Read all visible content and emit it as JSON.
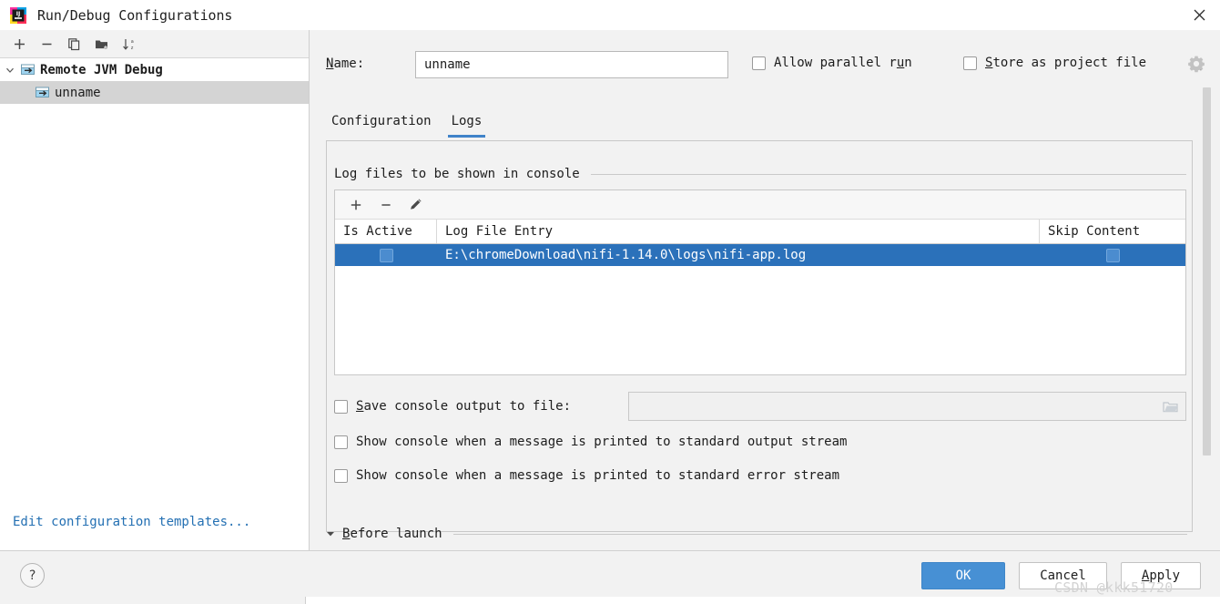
{
  "window": {
    "title": "Run/Debug Configurations",
    "logo_icon": "intellij-idea-logo",
    "close_icon": "close-icon"
  },
  "sidebar": {
    "toolbar": [
      {
        "icon": "plus-icon",
        "label": "+"
      },
      {
        "icon": "minus-icon",
        "label": "−"
      },
      {
        "icon": "copy-icon",
        "label": ""
      },
      {
        "icon": "folder-add-icon",
        "label": ""
      },
      {
        "icon": "sort-alphabetically-icon",
        "label": ""
      }
    ],
    "tree": [
      {
        "label": "Remote JVM Debug",
        "icon": "remote-jvm-debug-icon",
        "expanded": true,
        "selected": false
      },
      {
        "label": "unname",
        "icon": "run-config-icon",
        "expanded": false,
        "selected": true
      }
    ],
    "edit_templates_link": "Edit configuration templates..."
  },
  "main": {
    "name_label": "Name:",
    "name_label_mnemonic": "N",
    "name_value": "unname",
    "allow_parallel_run": {
      "label": "Allow parallel run",
      "mnemonic": "u",
      "checked": false
    },
    "store_as_project_file": {
      "label": "Store as project file",
      "mnemonic": "S",
      "checked": false
    },
    "gear_icon": "gear-dropdown-icon",
    "tabs": [
      {
        "label": "Configuration",
        "active": false
      },
      {
        "label": "Logs",
        "active": true
      }
    ]
  },
  "logs": {
    "section_title": "Log files to be shown in console",
    "table_toolbar": [
      {
        "icon": "plus-icon",
        "label": "+"
      },
      {
        "icon": "minus-icon",
        "label": "−"
      },
      {
        "icon": "edit-pencil-icon",
        "label": ""
      }
    ],
    "columns": [
      "Is Active",
      "Log File Entry",
      "Skip Content"
    ],
    "rows": [
      {
        "is_active": true,
        "log_file_entry": "E:\\chromeDownload\\nifi-1.14.0\\logs\\nifi-app.log",
        "skip_content": true,
        "selected": true
      }
    ],
    "save_console_output": {
      "label": "Save console output to file:",
      "mnemonic": "S",
      "checked": false,
      "value": "",
      "placeholder": "",
      "browse_icon": "folder-browse-icon"
    },
    "show_console_stdout": {
      "label": "Show console when a message is printed to standard output stream",
      "checked": false
    },
    "show_console_stderr": {
      "label": "Show console when a message is printed to standard error stream",
      "checked": false
    }
  },
  "before_launch": {
    "label": "Before launch",
    "mnemonic": "B",
    "expanded": true,
    "twisty_icon": "chevron-down-icon"
  },
  "footer": {
    "help_label": "?",
    "help_icon": "help-icon",
    "ok_label": "OK",
    "cancel_label": "Cancel",
    "apply_label": "Apply",
    "apply_mnemonic": "A"
  },
  "watermark": "CSDN @kkk51720",
  "colors": {
    "accent": "#2b71ba",
    "ok_button": "#4790d4",
    "tab_underline": "#4083c9",
    "link": "#2470b3",
    "selection_gray": "#d4d4d4"
  }
}
